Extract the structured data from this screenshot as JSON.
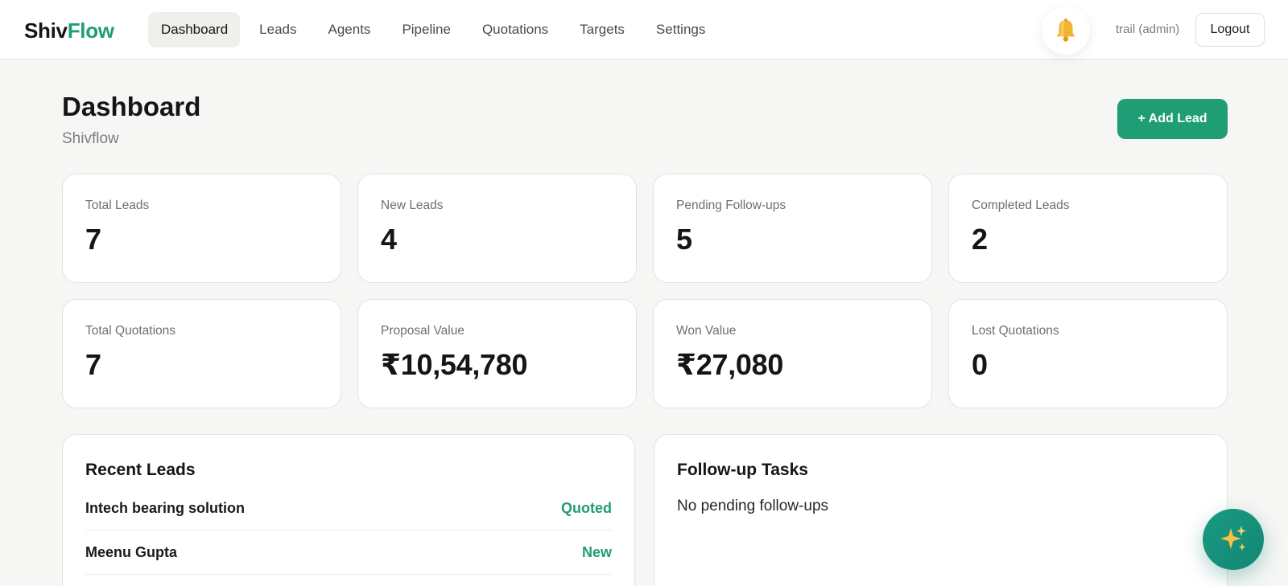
{
  "brand": {
    "part1": "Shiv",
    "part2": "Flow"
  },
  "nav": {
    "items": [
      {
        "label": "Dashboard",
        "active": true
      },
      {
        "label": "Leads"
      },
      {
        "label": "Agents"
      },
      {
        "label": "Pipeline"
      },
      {
        "label": "Quotations"
      },
      {
        "label": "Targets"
      },
      {
        "label": "Settings"
      }
    ]
  },
  "header_right": {
    "notification_icon": "bell-icon",
    "user_label": "trail (admin)",
    "logout_label": "Logout"
  },
  "page": {
    "title": "Dashboard",
    "subtitle": "Shivflow",
    "add_lead_label": "+ Add Lead"
  },
  "stats": [
    {
      "label": "Total Leads",
      "value": "7"
    },
    {
      "label": "New Leads",
      "value": "4"
    },
    {
      "label": "Pending Follow-ups",
      "value": "5"
    },
    {
      "label": "Completed Leads",
      "value": "2"
    },
    {
      "label": "Total Quotations",
      "value": "7"
    },
    {
      "label": "Proposal Value",
      "value": "₹10,54,780"
    },
    {
      "label": "Won Value",
      "value": "₹27,080"
    },
    {
      "label": "Lost Quotations",
      "value": "0"
    }
  ],
  "recent_leads": {
    "title": "Recent Leads",
    "items": [
      {
        "name": "Intech bearing solution",
        "status": "Quoted"
      },
      {
        "name": "Meenu Gupta",
        "status": "New"
      }
    ]
  },
  "followups": {
    "title": "Follow-up Tasks",
    "empty_message": "No pending follow-ups"
  },
  "assistant": {
    "icon": "sparkles-icon"
  },
  "colors": {
    "accent": "#1f9d75",
    "background": "#f6f6f4",
    "card": "#ffffff",
    "bell": "#f4b232"
  }
}
